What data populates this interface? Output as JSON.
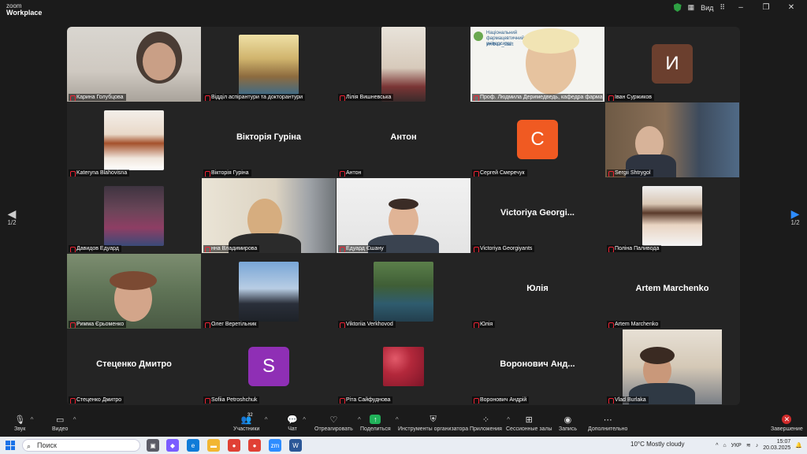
{
  "app": {
    "brand_line1": "zoom",
    "brand_line2": "Workplace",
    "view_label": "Вид"
  },
  "gallery": {
    "page_left": "1/2",
    "page_right": "1/2",
    "tiles": [
      {
        "name": "Карина Голубцова"
      },
      {
        "name": "Відділ аспірантури та докторантури"
      },
      {
        "name": "Лілія Вишневська"
      },
      {
        "name": "Проф. Людмила Деримедведь, кафедра фармак",
        "overlay_title": "Національний фармацевтичний університет",
        "overlay_sub": "#НФаУ_start"
      },
      {
        "name": "Іван Суржиков",
        "avatar_letter": "И"
      },
      {
        "name": "Kateryna Blahovisna"
      },
      {
        "name": "Вікторія Гуріна",
        "big_name": "Вікторія Гуріна"
      },
      {
        "name": "Антон",
        "big_name": "Антон"
      },
      {
        "name": "Сергей Смеречук",
        "avatar_letter": "С"
      },
      {
        "name": "Sergii Shtrygol"
      },
      {
        "name": "Давидов Едуард"
      },
      {
        "name": "нна Владимирова"
      },
      {
        "name": "Едуард Єшану"
      },
      {
        "name": "Victoriya Georgiyants",
        "big_name": "Victoriya Georgi..."
      },
      {
        "name": "Поліна Паливода"
      },
      {
        "name": "Римма Єрьоменко"
      },
      {
        "name": "Олег Веретільник"
      },
      {
        "name": "Viktoriia Verkhovod"
      },
      {
        "name": "Юлія",
        "big_name": "Юлія"
      },
      {
        "name": "Artem Marchenko",
        "big_name": "Artem Marchenko"
      },
      {
        "name": "Стеценко Дмитро",
        "big_name": "Стеценко Дмитро"
      },
      {
        "name": "Sofiia Petroshchuk",
        "avatar_letter": "S"
      },
      {
        "name": "Ріта Сайфуднова"
      },
      {
        "name": "Воронович Андрій",
        "big_name": "Воронович Анд..."
      },
      {
        "name": "Vlad Burlaka"
      }
    ]
  },
  "toolbar": {
    "audio": "Звук",
    "video": "Видео",
    "participants": "Участники",
    "participants_count": "32",
    "chat": "Чат",
    "react": "Отреагировать",
    "share": "Поделиться",
    "host_tools": "Инструменты организатора",
    "apps": "Приложения",
    "breakout": "Сессионные залы",
    "record": "Запись",
    "more": "Дополнительно",
    "end": "Завершение"
  },
  "taskbar": {
    "search_placeholder": "Поиск",
    "weather": "10°C  Mostly cloudy",
    "lang": "УКР",
    "time": "15:07",
    "date": "20.03.2025"
  },
  "colors": {
    "active_speaker": "#2fcf5c",
    "avatar_ivan": "#6b3f2e",
    "avatar_sergey": "#f05a22",
    "avatar_sofiia": "#8f2fb5",
    "share_green": "#21b25a",
    "end_red": "#d12b2b"
  }
}
